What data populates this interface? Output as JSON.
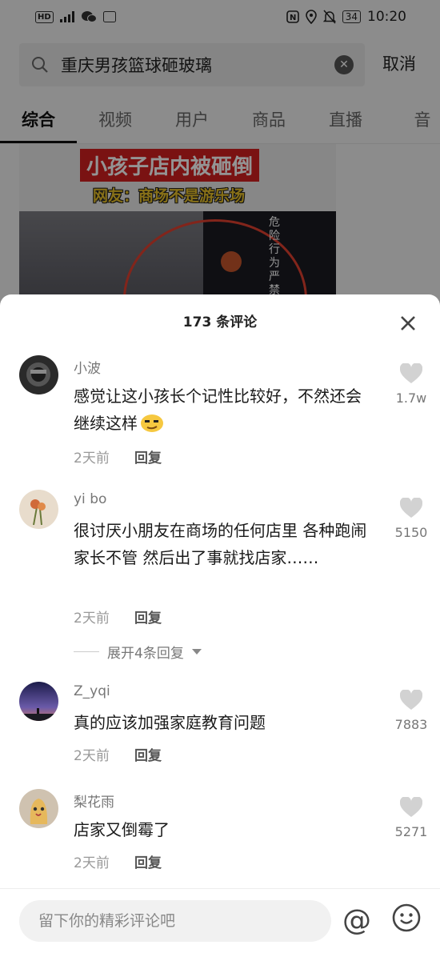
{
  "status_bar": {
    "left_chip": "HD",
    "battery": "34",
    "time": "10:20"
  },
  "search": {
    "query": "重庆男孩篮球砸玻璃",
    "cancel_label": "取消"
  },
  "tabs": [
    "综合",
    "视频",
    "用户",
    "商品",
    "直播",
    "音"
  ],
  "video": {
    "banner_title": "小孩子店内被砸倒",
    "banner_sub": "网友：商场不是游乐场",
    "side_text": "危险行为严禁"
  },
  "sheet": {
    "title": "173 条评论"
  },
  "comments": [
    {
      "user": "小波",
      "text": "感觉让这小孩长个记性比较好，不然还会继续这样",
      "time": "2天前",
      "reply": "回复",
      "likes": "1.7w"
    },
    {
      "user": "yi bo",
      "text": "很讨厌小朋友在商场的任何店里 各种跑闹 家长不管 然后出了事就找店家……",
      "time": "2天前",
      "reply": "回复",
      "likes": "5150",
      "expand": "展开4条回复"
    },
    {
      "user": "Z_yqi",
      "text": "真的应该加强家庭教育问题",
      "time": "2天前",
      "reply": "回复",
      "likes": "7883"
    },
    {
      "user": "梨花雨",
      "text": "店家又倒霉了",
      "time": "2天前",
      "reply": "回复",
      "likes": "5271"
    }
  ],
  "footer": {
    "input_placeholder": "留下你的精彩评论吧",
    "at_label": "@"
  },
  "colors": {
    "accent_red": "#d32020",
    "banner_yellow": "#e8c12a"
  }
}
